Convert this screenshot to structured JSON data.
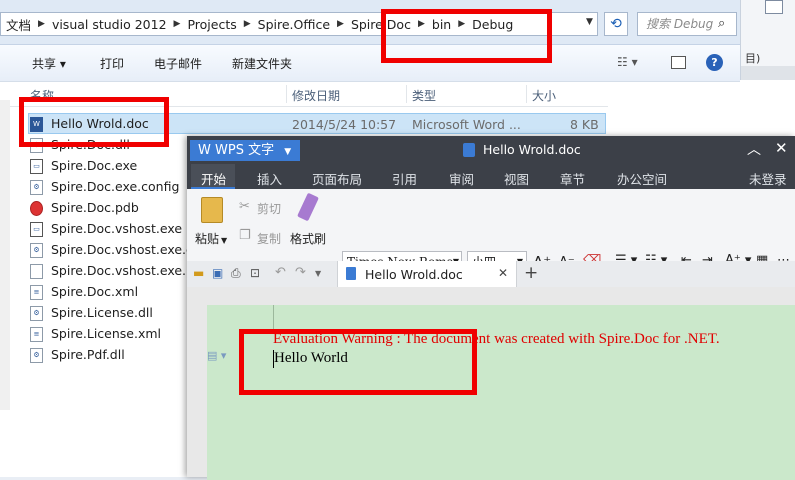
{
  "explorer": {
    "breadcrumbs": [
      "文档",
      "visual studio 2012",
      "Projects",
      "Spire.Office",
      "Spire.Doc",
      "bin",
      "Debug"
    ],
    "search_placeholder": "搜索 Debug",
    "toolbar": {
      "share": "共享",
      "print": "打印",
      "email": "电子邮件",
      "new_folder": "新建文件夹"
    },
    "columns": {
      "name": "名称",
      "modified": "修改日期",
      "type": "类型",
      "size": "大小"
    },
    "files": [
      {
        "name": "Hello Wrold.doc",
        "modified": "2014/5/24 10:57",
        "type": "Microsoft Word ...",
        "size": "8 KB",
        "icon": "word-doc-icon"
      },
      {
        "name": "Spire.Doc.dll",
        "icon": "dll-file-icon"
      },
      {
        "name": "Spire.Doc.exe",
        "icon": "exe-file-icon"
      },
      {
        "name": "Spire.Doc.exe.config",
        "icon": "config-file-icon"
      },
      {
        "name": "Spire.Doc.pdb",
        "icon": "pdb-file-icon"
      },
      {
        "name": "Spire.Doc.vshost.exe",
        "icon": "exe-file-icon"
      },
      {
        "name": "Spire.Doc.vshost.exe.co",
        "icon": "config-file-icon"
      },
      {
        "name": "Spire.Doc.vshost.exe.m",
        "icon": "file-icon"
      },
      {
        "name": "Spire.Doc.xml",
        "icon": "xml-file-icon"
      },
      {
        "name": "Spire.License.dll",
        "icon": "dll-file-icon"
      },
      {
        "name": "Spire.License.xml",
        "icon": "xml-file-icon"
      },
      {
        "name": "Spire.Pdf.dll",
        "icon": "dll-file-icon"
      }
    ]
  },
  "right_window": {
    "text": "目)"
  },
  "wps": {
    "app_name": "WPS 文字",
    "title": "Hello Wrold.doc",
    "login": "未登录",
    "tabs": [
      "开始",
      "插入",
      "页面布局",
      "引用",
      "审阅",
      "视图",
      "章节",
      "办公空间"
    ],
    "clipboard": {
      "paste": "粘贴",
      "cut": "剪切",
      "copy": "复制",
      "format_painter": "格式刷"
    },
    "font_name": "Times New Roma",
    "font_size": "小四",
    "doc_tab": "Hello Wrold.doc",
    "document": {
      "warning": "Evaluation Warning : The document was created with Spire.Doc for .NET.",
      "body": "Hello World"
    }
  },
  "colors": {
    "highlight": "#f00000",
    "wps_title_bar": "#3c4048",
    "wps_accent": "#3b7bd4",
    "page_bg": "#cbe8cb",
    "warning_text": "#e00000"
  }
}
